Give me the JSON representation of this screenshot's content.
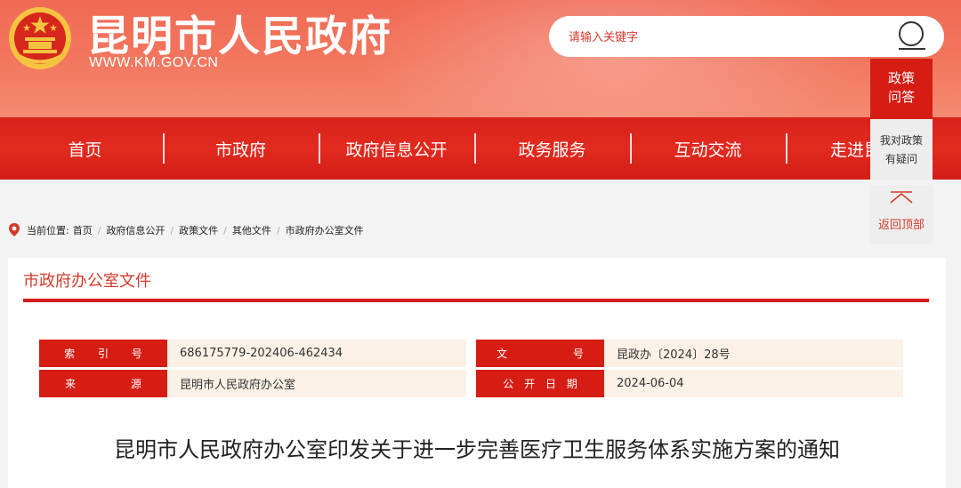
{
  "site": {
    "title": "昆明市人民政府",
    "url": "WWW.KM.GOV.CN"
  },
  "search": {
    "placeholder": "请输入关键字"
  },
  "nav": {
    "items": [
      "首页",
      "市政府",
      "政府信息公开",
      "政务服务",
      "互动交流",
      "走进昆"
    ]
  },
  "side_panel": {
    "top_label_line1": "政策",
    "top_label_line2": "问答",
    "mid_label_line1": "我对政策",
    "mid_label_line2": "有疑问",
    "back_to_top": "返回顶部"
  },
  "breadcrumb": {
    "prefix": "当前位置:",
    "items": [
      "首页",
      "政府信息公开",
      "政策文件",
      "其他文件",
      "市政府办公室文件"
    ]
  },
  "section": {
    "title": "市政府办公室文件"
  },
  "meta": {
    "index_label": "索 引 号",
    "index_value": "686175779-202406-462434",
    "doc_no_label": "文 号",
    "doc_no_value": "昆政办〔2024〕28号",
    "source_label": "来 源",
    "source_value": "昆明市人民政府办公室",
    "date_label": "公 开 日 期",
    "date_value": "2024-06-04"
  },
  "document": {
    "title": "昆明市人民政府办公室印发关于进一步完善医疗卫生服务体系实施方案的通知"
  },
  "colors": {
    "brand_red": "#d51d14",
    "header_red": "#f06a55",
    "meta_bg": "#fbf1e6"
  }
}
